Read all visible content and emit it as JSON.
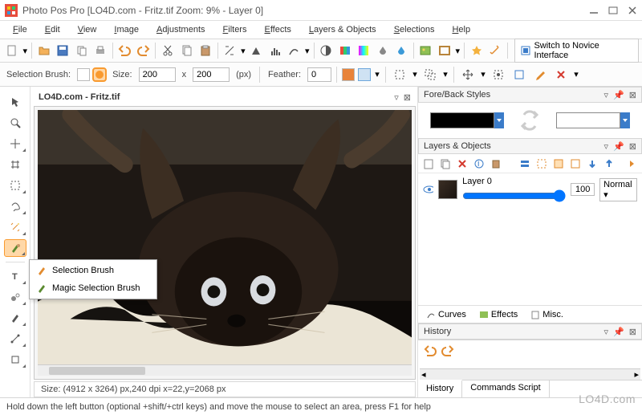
{
  "window": {
    "title": "Photo Pos Pro [LO4D.com - Fritz.tif Zoom: 9% - Layer 0]"
  },
  "menubar": {
    "items": [
      "File",
      "Edit",
      "View",
      "Image",
      "Adjustments",
      "Filters",
      "Effects",
      "Layers & Objects",
      "Selections",
      "Help"
    ]
  },
  "toolbar": {
    "novice_label": "Switch to Novice Interface"
  },
  "options": {
    "selection_brush_label": "Selection Brush:",
    "size_label": "Size:",
    "width": "200",
    "x_label": "x",
    "height": "200",
    "unit": "(px)",
    "feather_label": "Feather:",
    "feather_value": "0"
  },
  "document": {
    "tab_label": "LO4D.com - Fritz.tif",
    "info": "Size: (4912 x 3264) px,240 dpi    x=22,y=2068 px"
  },
  "flyout": {
    "items": [
      "Selection Brush",
      "Magic Selection Brush"
    ]
  },
  "panels": {
    "foreback": {
      "title": "Fore/Back Styles"
    },
    "layers": {
      "title": "Layers & Objects",
      "layer0": {
        "name": "Layer 0",
        "opacity": "100",
        "blend": "Normal"
      },
      "subtabs": [
        "Curves",
        "Effects",
        "Misc."
      ]
    },
    "history": {
      "title": "History",
      "tabs": [
        "History",
        "Commands Script"
      ]
    }
  },
  "statusbar": {
    "text": "Hold down the left button (optional +shift/+ctrl keys) and move the mouse to select an area, press F1 for help"
  },
  "watermark": "LO4D.com"
}
